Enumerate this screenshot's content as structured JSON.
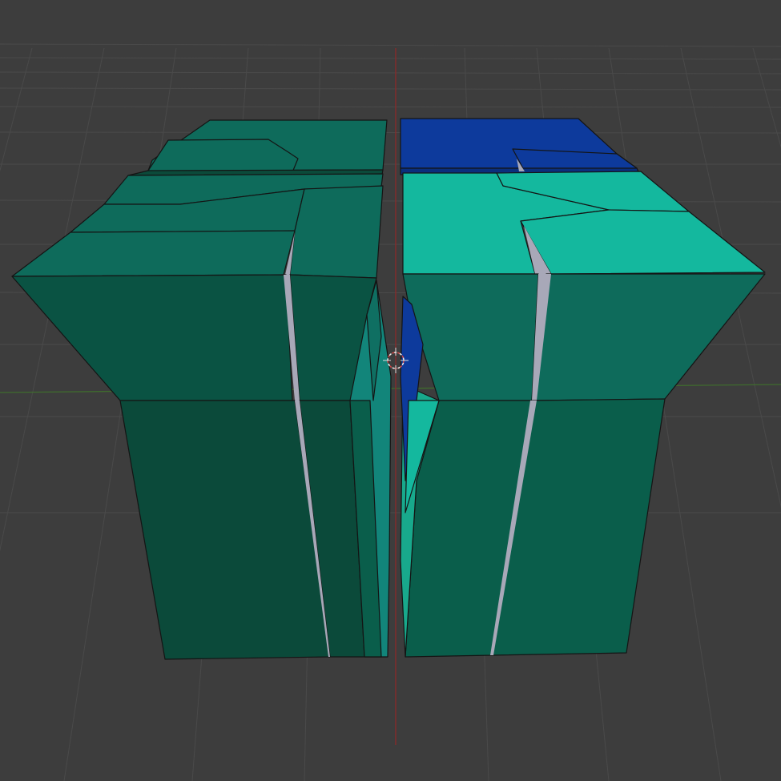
{
  "viewport": {
    "view": "3d-viewport",
    "background_color": "#3d3d3d",
    "grid_color": "#4a4a4a",
    "axis_x_color": "#3f6b2e",
    "axis_z_color": "#8b2a2a",
    "cursor_icon": "3d-cursor-icon",
    "object": "fractured-cube",
    "colors": {
      "dark_green": "#0b4a3a",
      "mid_green": "#0a5e4b",
      "top_green": "#0e6b5b",
      "bright_teal": "#14b89e",
      "light_teal": "#18a98c",
      "blue": "#0d3a9c",
      "crack_grey": "#a8a8b8"
    }
  }
}
